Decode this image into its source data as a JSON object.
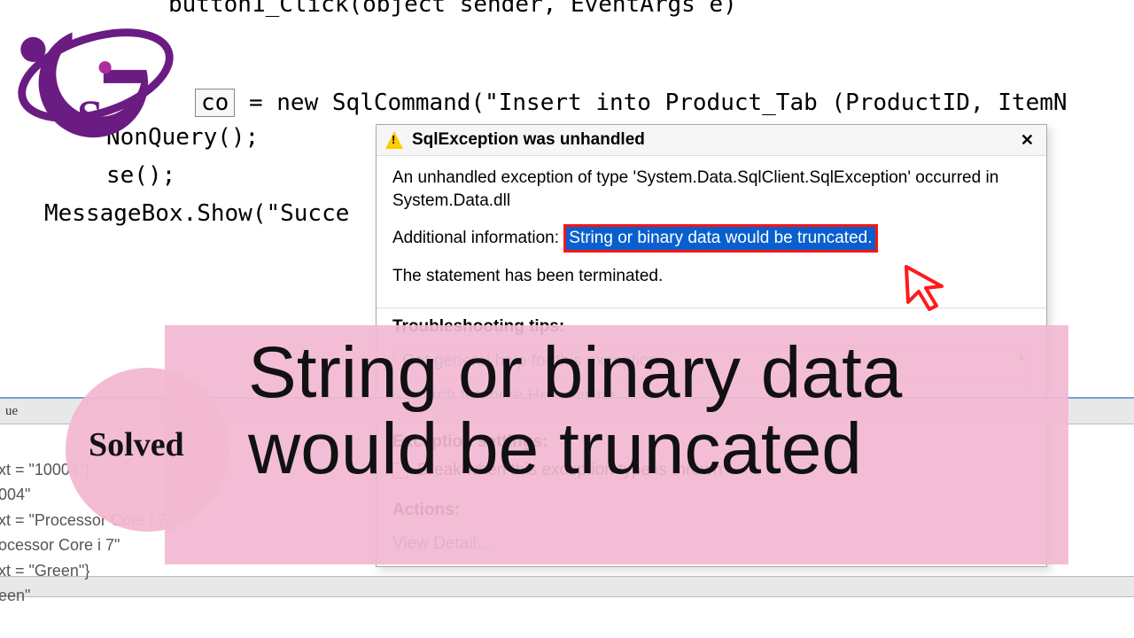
{
  "code": {
    "line1": "button1_Click(object sender, EventArgs e)",
    "line2_pre": "co",
    "line2_eq": " = ",
    "line2_new": "new",
    "line2_type": " SqlCommand",
    "line2_str": "(\"Insert into Product_Tab (ProductID, ItemN",
    "line3_run": "NonQuery();",
    "line4": "se();",
    "line5_obj": "MessageBox",
    "line5_rest": ".Show(",
    "line5_str": "\"Succe"
  },
  "dialog": {
    "title": "SqlException was unhandled",
    "body1": "An unhandled exception of type 'System.Data.SqlClient.SqlException' occurred in System.Data.dll",
    "body2_label": "Additional information:",
    "body2_err": "String or binary data would be truncated.",
    "body3": "The statement has been terminated.",
    "tips_header": "Troubleshooting tips:",
    "tips_item1": "Get general help for this exception.",
    "tips_item2": "Search for more Help Online...",
    "exc_header": "Exception settings:",
    "exc_check": "Break when this exception type is thrown",
    "actions_header": "Actions:",
    "actions_link": "View Detail..."
  },
  "overlay": {
    "big_line1": "String or binary data",
    "big_line2": "would be truncated",
    "solved": "Solved"
  },
  "debug": {
    "hdr": "ue",
    "l1": "xt = \"10004\"}",
    "l2": "004\"",
    "l3": "xt = \"Processor Core i 7\"}",
    "l4": "ocessor Core i 7\"",
    "l5": "xt = \"Green\"}",
    "l6": "een\""
  }
}
